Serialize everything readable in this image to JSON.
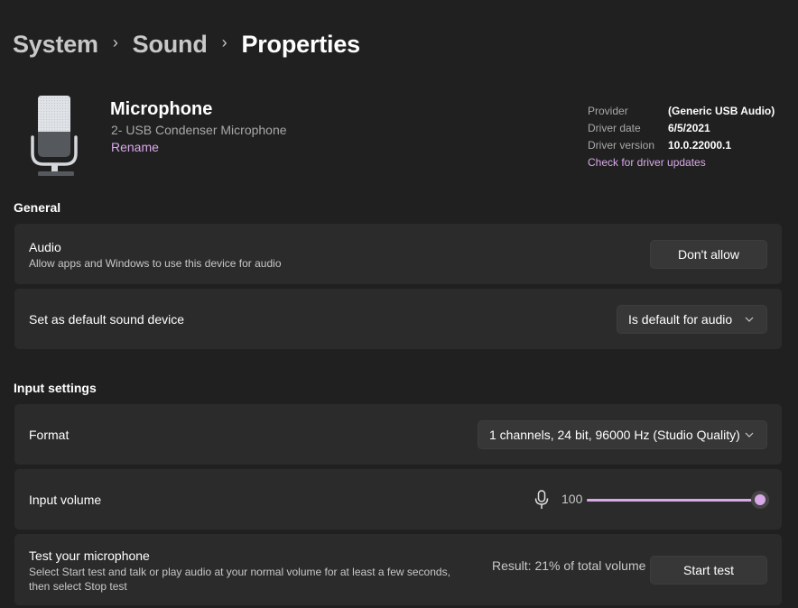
{
  "breadcrumb": {
    "items": [
      "System",
      "Sound",
      "Properties"
    ],
    "separator": "›"
  },
  "device": {
    "name": "Microphone",
    "model": "2- USB Condenser Microphone",
    "rename_label": "Rename",
    "icon": "microphone-device-icon"
  },
  "driver": {
    "provider_label": "Provider",
    "provider_value": "(Generic USB Audio)",
    "date_label": "Driver date",
    "date_value": "6/5/2021",
    "version_label": "Driver version",
    "version_value": "10.0.22000.1",
    "update_link": "Check for driver updates"
  },
  "general": {
    "title": "General",
    "audio": {
      "title": "Audio",
      "description": "Allow apps and Windows to use this device for audio",
      "button_label": "Don't allow"
    },
    "default_device": {
      "title": "Set as default sound device",
      "selected": "Is default for audio"
    }
  },
  "input_settings": {
    "title": "Input settings",
    "format": {
      "title": "Format",
      "selected": "1 channels, 24 bit, 96000 Hz (Studio Quality)"
    },
    "input_volume": {
      "title": "Input volume",
      "value": 100,
      "value_label": "100",
      "max": 100,
      "icon": "microphone-icon"
    },
    "test": {
      "title": "Test your microphone",
      "description_line1": "Select Start test and talk or play audio at your normal volume for at least a few seconds,",
      "description_line2": "then select Stop test",
      "result": "Result: 21% of total volume",
      "button_label": "Start test"
    }
  },
  "colors": {
    "accent": "#d8a8e8",
    "background": "#202020",
    "card": "#2b2b2b",
    "button": "#373737"
  }
}
